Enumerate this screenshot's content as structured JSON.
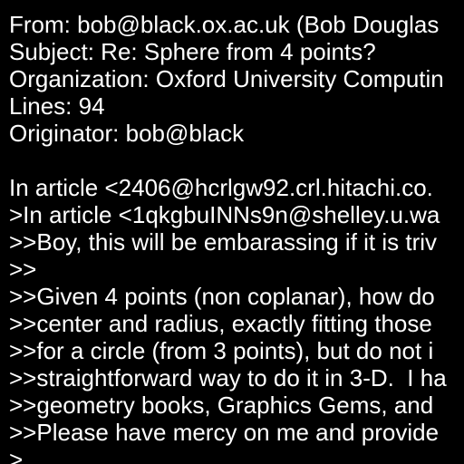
{
  "document": {
    "header": {
      "from": "From: bob@black.ox.ac.uk (Bob Douglas",
      "subject": "Subject: Re: Sphere from 4 points?",
      "organization": "Organization: Oxford University Computin",
      "lines": "Lines: 94",
      "originator": "Originator: bob@black"
    },
    "body": [
      "In article <2406@hcrlgw92.crl.hitachi.co.",
      ">In article <1qkgbuINNs9n@shelley.u.wa",
      ">>Boy, this will be embarassing if it is triv",
      ">>",
      ">>Given 4 points (non coplanar), how do",
      ">>center and radius, exactly fitting those",
      ">>for a circle (from 3 points), but do not i",
      ">>straightforward way to do it in 3-D.  I ha",
      ">>geometry books, Graphics Gems, and",
      ">>Please have mercy on me and provide",
      ">"
    ]
  },
  "colors": {
    "background": "#000000",
    "text": "#ffffff"
  }
}
